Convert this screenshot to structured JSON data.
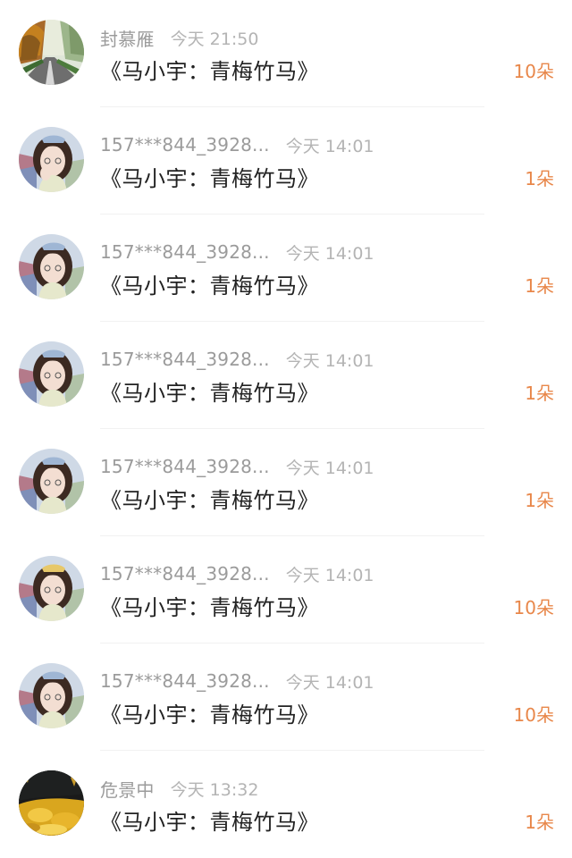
{
  "items": [
    {
      "name": "封慕雁",
      "time": "今天 21:50",
      "title": "《马小宇：青梅竹马》",
      "count": "10朵",
      "avatar": "landscape-avatar"
    },
    {
      "name": "157***844_3928...",
      "time": "今天 14:01",
      "title": "《马小宇：青梅竹马》",
      "count": "1朵",
      "avatar": "girl-avatar"
    },
    {
      "name": "157***844_3928...",
      "time": "今天 14:01",
      "title": "《马小宇：青梅竹马》",
      "count": "1朵",
      "avatar": "girl-avatar"
    },
    {
      "name": "157***844_3928...",
      "time": "今天 14:01",
      "title": "《马小宇：青梅竹马》",
      "count": "1朵",
      "avatar": "girl-avatar"
    },
    {
      "name": "157***844_3928...",
      "time": "今天 14:01",
      "title": "《马小宇：青梅竹马》",
      "count": "1朵",
      "avatar": "girl-avatar"
    },
    {
      "name": "157***844_3928...",
      "time": "今天 14:01",
      "title": "《马小宇：青梅竹马》",
      "count": "10朵",
      "avatar": "girl-avatar"
    },
    {
      "name": "157***844_3928...",
      "time": "今天 14:01",
      "title": "《马小宇：青梅竹马》",
      "count": "10朵",
      "avatar": "girl-avatar"
    },
    {
      "name": "危景中",
      "time": "今天 13:32",
      "title": "《马小宇：青梅竹马》",
      "count": "1朵",
      "avatar": "gold-leaves-avatar"
    }
  ],
  "colors": {
    "count": "#e8874a",
    "name": "#9b9b9b",
    "time": "#b4b4b4",
    "title": "#222222"
  }
}
